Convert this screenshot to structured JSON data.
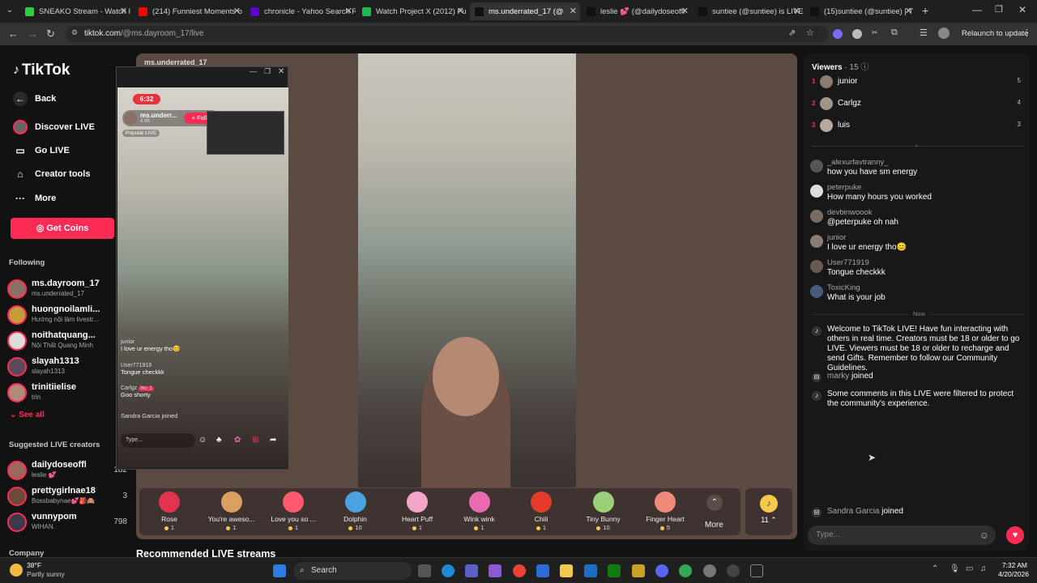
{
  "browser": {
    "tabs": [
      {
        "title": "SNEAKO Stream - Watch I",
        "color": "#2ecc40"
      },
      {
        "title": "(214) Funniest Moments o",
        "color": "#ff0000"
      },
      {
        "title": "chronicle - Yahoo Search R",
        "color": "#6001d2"
      },
      {
        "title": "Watch Project X (2012) Fu",
        "color": "#1db954"
      },
      {
        "title": "ms.underrated_17 (@",
        "color": "#111111"
      },
      {
        "title": "leslie 💕 (@dailydoseoffl",
        "color": "#111111"
      },
      {
        "title": "suntiee (@suntiee) is LIVE",
        "color": "#111111"
      },
      {
        "title": "(15)suntiee (@suntiee) | T",
        "color": "#111111"
      }
    ],
    "url_host": "tiktok.com",
    "url_path": "/@ms.dayroom_17/live",
    "relaunch_label": "Relaunch to update"
  },
  "sidebar": {
    "logo": "TikTok",
    "back": "Back",
    "nav": [
      "Discover LIVE",
      "Go LIVE",
      "Creator tools",
      "More"
    ],
    "get_coins": "Get Coins",
    "following_header": "Following",
    "following": [
      {
        "name": "ms.dayroom_17",
        "sub": "ms.underrated_17"
      },
      {
        "name": "huongnoilamli...",
        "sub": "Hướng nội làm livestr..."
      },
      {
        "name": "noithatquang...",
        "sub": "Nội Thất Quang Minh"
      },
      {
        "name": "slayah1313",
        "sub": "slayah1313"
      },
      {
        "name": "trinitiielise",
        "sub": "trin"
      }
    ],
    "see_all": "See all",
    "suggested_header": "Suggested LIVE creators",
    "suggested": [
      {
        "name": "dailydoseoffl",
        "sub": "leslie 💕",
        "count": "182"
      },
      {
        "name": "prettygirlnae18",
        "sub": "Bossbabynae💕🎒🙈",
        "count": "3"
      },
      {
        "name": "vunnypom",
        "sub": "WIHAN.",
        "count": "798"
      }
    ],
    "company": "Company"
  },
  "stage": {
    "host_label": "ms.underrated_17",
    "recommended": "Recommended LIVE streams",
    "gifts": [
      {
        "name": "Rose",
        "price": "1",
        "color": "#e0344f"
      },
      {
        "name": "You're aweso...",
        "price": "1",
        "color": "#d9a061"
      },
      {
        "name": "Love you so ...",
        "price": "1",
        "color": "#ff5a6e"
      },
      {
        "name": "Dolphin",
        "price": "10",
        "color": "#4aa3e0"
      },
      {
        "name": "Heart Puff",
        "price": "1",
        "color": "#f2a7c9"
      },
      {
        "name": "Wink wink",
        "price": "1",
        "color": "#e96ab0"
      },
      {
        "name": "Chili",
        "price": "1",
        "color": "#e23b2a"
      },
      {
        "name": "Tiny Bunny",
        "price": "10",
        "color": "#9bd07a"
      },
      {
        "name": "Finger Heart",
        "price": "5",
        "color": "#f08a7a"
      }
    ],
    "more_label": "More",
    "coins_count": "11"
  },
  "popup": {
    "time": "6:32",
    "host": "ms.underr...",
    "likes": "4.9K",
    "follow": "+ Follo",
    "popular": "Popular LIVE",
    "chat": [
      {
        "user": "junior",
        "text": "I love ur energy tho😊"
      },
      {
        "user": "User771919",
        "text": "Tongue checkkk"
      },
      {
        "user": "Carlgz",
        "text": "Goo shorty",
        "badge": "No. 2"
      }
    ],
    "joined": "Sandra Garcia joined",
    "input": "Type..."
  },
  "chat": {
    "viewers_label": "Viewers",
    "viewers_count": "· 15",
    "top_viewers": [
      {
        "rank": "1",
        "name": "junior",
        "score": "5"
      },
      {
        "rank": "2",
        "name": "Carlgz",
        "score": "4"
      },
      {
        "rank": "3",
        "name": "luis",
        "score": "3"
      }
    ],
    "comments": [
      {
        "user": "_alexurfavtranny_",
        "text": "how you have sm energy"
      },
      {
        "user": "peterpuke",
        "text": "How many hours you worked"
      },
      {
        "user": "devbinwoook",
        "text": "@peterpuke oh nah"
      },
      {
        "user": "junior",
        "text": "I love ur energy tho😊"
      },
      {
        "user": "User771919",
        "text": "Tongue checkkk"
      },
      {
        "user": "ToxicKing",
        "text": "What is your job"
      }
    ],
    "now_label": "Now",
    "welcome": "Welcome to TikTok LIVE! Have fun interacting with others in real time. Creators must be 18 or older to go LIVE. Viewers must be 18 or older to recharge and send Gifts. Remember to follow our Community Guidelines.",
    "marky_user": "marky",
    "joined_label": "joined",
    "filtered": "Some comments in this LIVE were filtered to protect the community's experience.",
    "sandra_user": "Sandra Garcia",
    "input_placeholder": "Type..."
  },
  "taskbar": {
    "weather_temp": "38°F",
    "weather_desc": "Partly sunny",
    "search": "Search",
    "time": "7:32 AM",
    "date": "4/20/2026"
  }
}
